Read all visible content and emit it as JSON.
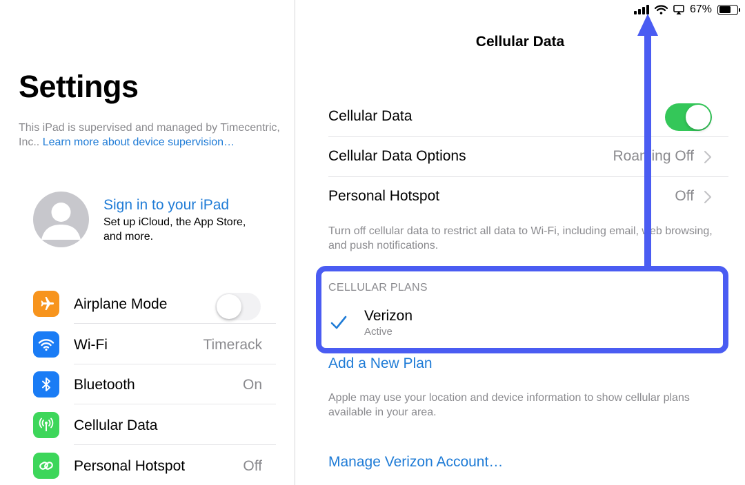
{
  "status_bar": {
    "battery_percent": "67%",
    "battery_level": 0.67,
    "icons": [
      "cellular-signal-icon",
      "wifi-icon",
      "airplay-icon",
      "battery-icon"
    ]
  },
  "sidebar": {
    "title": "Settings",
    "supervision_text": "This iPad is supervised and managed by Timecentric, Inc.. ",
    "supervision_link": "Learn more about device supervision…",
    "account": {
      "title": "Sign in to your iPad",
      "subtitle": "Set up iCloud, the App Store, and more."
    },
    "items": [
      {
        "label": "Airplane Mode",
        "value": "",
        "icon": "airplane-icon",
        "icon_color": "#f7941d",
        "toggle": false
      },
      {
        "label": "Wi-Fi",
        "value": "Timerack",
        "icon": "wifi-icon",
        "icon_color": "#1a7cf5"
      },
      {
        "label": "Bluetooth",
        "value": "On",
        "icon": "bluetooth-icon",
        "icon_color": "#1a7cf5"
      },
      {
        "label": "Cellular Data",
        "value": "",
        "icon": "antenna-icon",
        "icon_color": "#3dd65a"
      },
      {
        "label": "Personal Hotspot",
        "value": "Off",
        "icon": "hotspot-icon",
        "icon_color": "#3dd65a"
      }
    ]
  },
  "main": {
    "nav_title": "Cellular Data",
    "rows": [
      {
        "label": "Cellular Data",
        "value": "",
        "toggle": true
      },
      {
        "label": "Cellular Data Options",
        "value": "Roaming Off"
      },
      {
        "label": "Personal Hotspot",
        "value": "Off"
      }
    ],
    "footnote_1": "Turn off cellular data to restrict all data to Wi-Fi, including email, web browsing, and push notifications.",
    "plans_header": "CELLULAR PLANS",
    "plan": {
      "name": "Verizon",
      "status": "Active",
      "selected": true
    },
    "add_plan": "Add a New Plan",
    "footnote_2": "Apple may use your location and device information to show cellular plans available in your area.",
    "manage_account": "Manage Verizon Account…"
  },
  "colors": {
    "accent_blue": "#1e7bd6",
    "toggle_on": "#34c759",
    "annotation": "#4a5cf2"
  }
}
